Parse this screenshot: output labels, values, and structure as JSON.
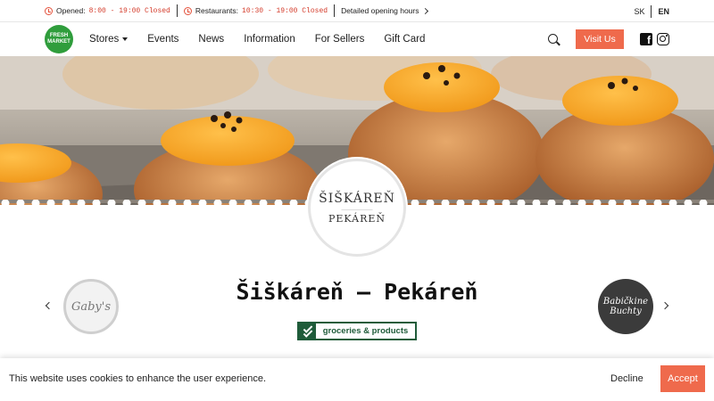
{
  "topbar": {
    "opened_label": "Opened:",
    "opened_hours": "8:00 - 19:00 Closed",
    "restaurants_label": "Restaurants:",
    "restaurants_hours": "10:30 - 19:00 Closed",
    "detailed_link": "Detailed opening hours",
    "lang_sk": "SK",
    "lang_en": "EN"
  },
  "brand": {
    "logo_line1": "FRESH",
    "logo_line2": "MARKET",
    "accent": "#ef6a4c",
    "green": "#2f9d3c"
  },
  "nav": {
    "items": [
      "Stores",
      "Events",
      "News",
      "Information",
      "For Sellers",
      "Gift Card"
    ],
    "visit_button": "Visit Us"
  },
  "store": {
    "badge_line1": "ŠIŠKÁREŇ",
    "badge_line2": "PEKÁREŇ",
    "title": "Šiškáreň – Pekáreň",
    "category": "groceries & products",
    "prev_logo": "Gaby's",
    "next_logo_line1": "Babičkine",
    "next_logo_line2": "Buchty"
  },
  "cookie": {
    "text": "This website uses cookies to enhance the user experience.",
    "decline": "Decline",
    "accept": "Accept"
  }
}
